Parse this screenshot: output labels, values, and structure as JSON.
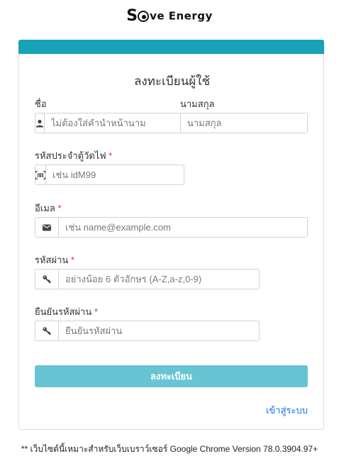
{
  "brand": {
    "letter_s": "S",
    "rest": "ve Energy"
  },
  "form": {
    "title": "ลงทะเบียนผู้ใช้",
    "first_name": {
      "label": "ชื่อ",
      "placeholder": "ไม่ต้องใส่คำนำหน้านาม"
    },
    "last_name": {
      "label": "นามสกุล",
      "placeholder": "นามสกุล"
    },
    "meter_code": {
      "label": "รหัสประจำตู้วัดไฟ",
      "required": "*",
      "placeholder": "เช่น idM99"
    },
    "email": {
      "label": "อีเมล",
      "required": "*",
      "placeholder": "เช่น name@example.com"
    },
    "password": {
      "label": "รหัสผ่าน",
      "required": "*",
      "placeholder": "อย่างน้อย 6 ตัวอักษร (A-Z,a-z,0-9)"
    },
    "confirm_password": {
      "label": "ยืนยันรหัสผ่าน",
      "required": "*",
      "placeholder": "ยืนยันรหัสผ่าน"
    },
    "submit_label": "ลงทะเบียน",
    "login_link": "เข้าสู่ระบบ"
  },
  "footer": {
    "note": "** เว็บไซต์นี้เหมาะสำหรับเว็บเบราว์เซอร์ Google Chrome Version 78.0.3904.97+"
  },
  "colors": {
    "accent": "#17a2b8",
    "button": "#67c5d3",
    "link": "#1a73e8",
    "required": "#dc3545"
  },
  "icons": {
    "first_name": "user-icon",
    "meter_code": "barcode-icon",
    "email": "envelope-icon",
    "password": "key-icon",
    "confirm_password": "key-icon"
  }
}
